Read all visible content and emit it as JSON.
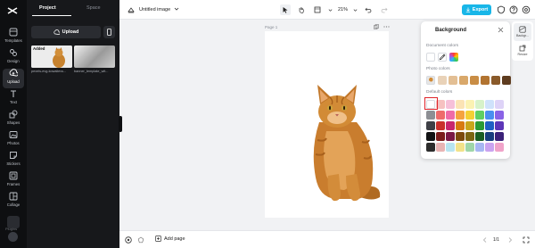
{
  "app": {
    "document_title": "Untitled image"
  },
  "rail": {
    "items": [
      {
        "label": "Templates",
        "icon": "templates-icon"
      },
      {
        "label": "Design",
        "icon": "design-icon"
      },
      {
        "label": "Upload",
        "icon": "upload-icon",
        "active": true
      },
      {
        "label": "Text",
        "icon": "text-icon"
      },
      {
        "label": "Shapes",
        "icon": "shapes-icon"
      },
      {
        "label": "Photos",
        "icon": "photos-icon"
      },
      {
        "label": "Stickers",
        "icon": "stickers-icon"
      },
      {
        "label": "Frames",
        "icon": "frames-icon"
      },
      {
        "label": "Collage",
        "icon": "collage-icon"
      }
    ],
    "plugins_label": "Plugins"
  },
  "panel": {
    "tabs": [
      "Project",
      "Space"
    ],
    "upload_label": "Upload",
    "assets": [
      {
        "name": "pexels-evg-kowalievs...",
        "badge": "Added"
      },
      {
        "name": "banner_template_wit..."
      }
    ]
  },
  "toolbar": {
    "zoom": "21%",
    "export_label": "Export"
  },
  "canvas": {
    "page_label": "Page 1"
  },
  "background_panel": {
    "title": "Background",
    "document_colors_label": "Document colors",
    "photo_colors_label": "Photo colors",
    "default_colors_label": "Default colors",
    "photo_colors": [
      "#e9d2b8",
      "#e3bf94",
      "#d9a86a",
      "#c98d45",
      "#b27431",
      "#8a5a2a",
      "#5e3c1f"
    ],
    "default_colors": [
      [
        "#ffffff",
        "#f6c1c1",
        "#f6c0d9",
        "#fbe3b5",
        "#fbf2b3",
        "#d7f2c9",
        "#cfe2fb",
        "#ded3f7"
      ],
      [
        "#8d8f94",
        "#ee6b6b",
        "#ef6ba8",
        "#f5a340",
        "#f4d035",
        "#5fcf63",
        "#4a8ff0",
        "#8a63e6"
      ],
      [
        "#3e4046",
        "#c9302c",
        "#c8276f",
        "#d87a12",
        "#c9a61d",
        "#2b9a35",
        "#1f5fc4",
        "#5d36b8"
      ],
      [
        "#111214",
        "#7a1c1c",
        "#7a1846",
        "#7d4a0c",
        "#7d6612",
        "#1a5e22",
        "#173d7d",
        "#3b2178"
      ],
      [
        "#2c2c2c",
        "#e8b4b4",
        "#b7e4f0",
        "#f2e28a",
        "#9fd6a8",
        "#a7b7f2",
        "#caa3f0",
        "#f0a3c9"
      ]
    ]
  },
  "side_rail": {
    "items": [
      {
        "label": "Backgr...",
        "icon": "background-icon",
        "active": true
      },
      {
        "label": "Resize",
        "icon": "resize-icon"
      }
    ]
  },
  "bottombar": {
    "add_page_label": "Add page",
    "page_count": "1/1"
  }
}
